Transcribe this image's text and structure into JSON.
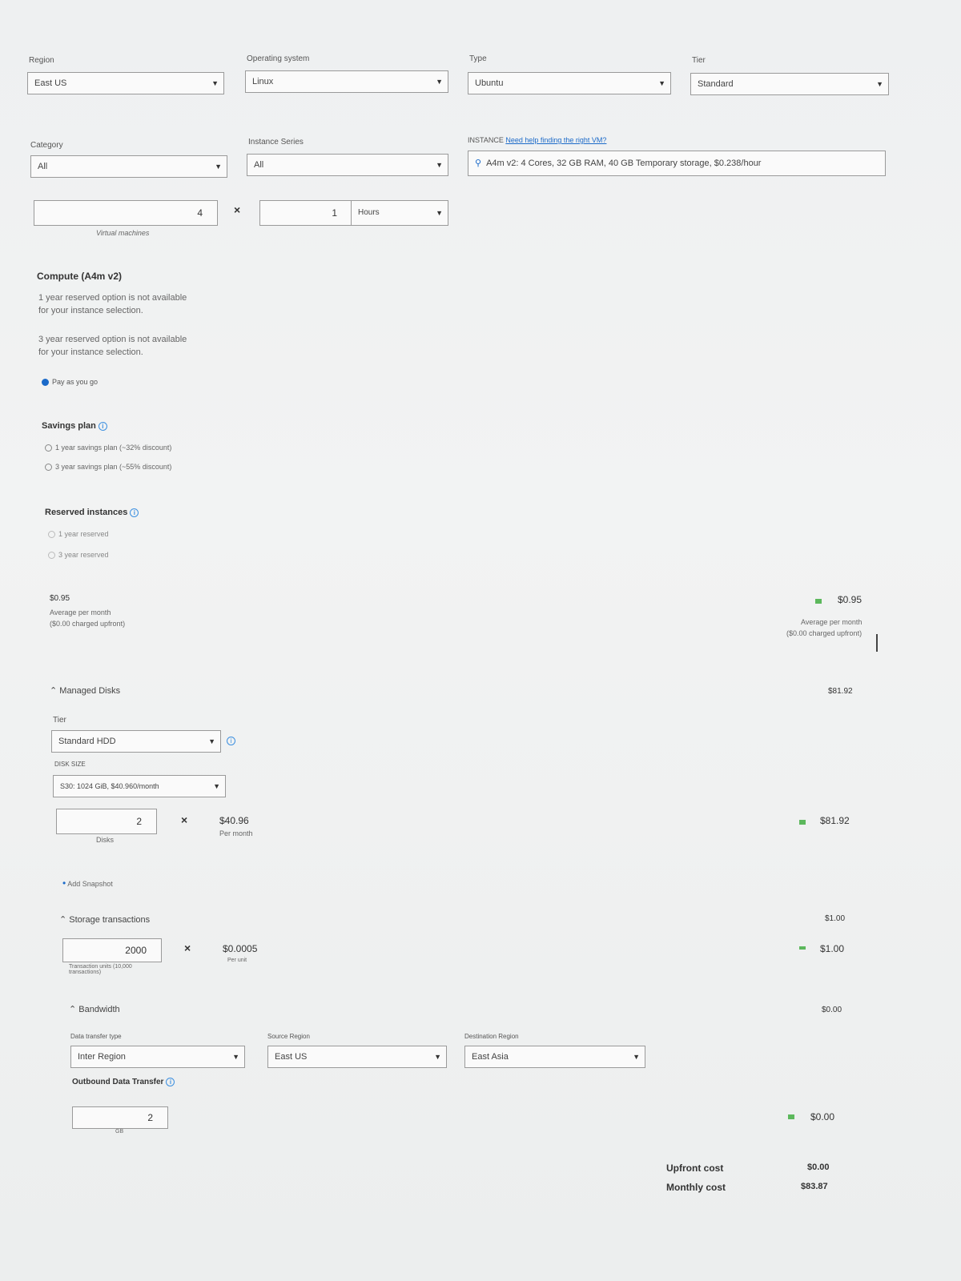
{
  "filters_row1": {
    "region": {
      "label": "Region",
      "value": "East US"
    },
    "os": {
      "label": "Operating system",
      "value": "Linux"
    },
    "type": {
      "label": "Type",
      "value": "Ubuntu"
    },
    "tier": {
      "label": "Tier",
      "value": "Standard"
    }
  },
  "filters_row2": {
    "category": {
      "label": "Category",
      "value": "All"
    },
    "series": {
      "label": "Instance Series",
      "value": "All"
    },
    "instance": {
      "label": "INSTANCE",
      "help": "Need help finding the right VM?",
      "value": "A4m v2: 4 Cores, 32 GB RAM, 40 GB Temporary storage, $0.238/hour"
    }
  },
  "vm": {
    "count": "4",
    "count_caption": "Virtual machines",
    "hours": "1",
    "unit": "Hours"
  },
  "compute": {
    "title": "Compute (A4m v2)",
    "note1a": "1 year reserved option is not available",
    "note1b": "for your instance selection.",
    "note2a": "3 year reserved option is not available",
    "note2b": "for your instance selection.",
    "payg": "Pay as you go",
    "savings_title": "Savings plan",
    "savings1": "1 year savings plan (~32% discount)",
    "savings3": "3 year savings plan (~55% discount)",
    "reserved_title": "Reserved instances",
    "reserved1": "1 year reserved",
    "reserved3": "3 year reserved",
    "price": "$0.95",
    "avg": "Average per month",
    "upfront": "($0.00 charged upfront)",
    "right_price": "$0.95",
    "right_avg": "Average per month",
    "right_upfront": "($0.00 charged upfront)"
  },
  "disks": {
    "title": "Managed Disks",
    "total": "$81.92",
    "tier_label": "Tier",
    "tier_value": "Standard HDD",
    "size_label": "DISK SIZE",
    "size_value": "S30: 1024 GiB, $40.960/month",
    "count": "2",
    "count_caption": "Disks",
    "per_disk": "$40.96",
    "per_disk_caption": "Per month",
    "line_total": "$81.92",
    "snapshot": "Add Snapshot"
  },
  "storage": {
    "title": "Storage transactions",
    "total": "$1.00",
    "count": "2000",
    "count_caption": "Transaction units (10,000 transactions)",
    "unit_price": "$0.0005",
    "unit_caption": "Per unit",
    "line_total": "$1.00"
  },
  "bandwidth": {
    "title": "Bandwidth",
    "total": "$0.00",
    "transfer_label": "Data transfer type",
    "transfer_value": "Inter Region",
    "source_label": "Source Region",
    "source_value": "East US",
    "dest_label": "Destination Region",
    "dest_value": "East Asia",
    "outbound_title": "Outbound Data Transfer",
    "outbound_value": "2",
    "outbound_unit": "GB",
    "line_total": "$0.00"
  },
  "summary": {
    "upfront_label": "Upfront cost",
    "upfront_value": "$0.00",
    "monthly_label": "Monthly cost",
    "monthly_value": "$83.87"
  },
  "colors": {
    "accent": "#1b6ac9",
    "equals": "#5cb85c"
  }
}
